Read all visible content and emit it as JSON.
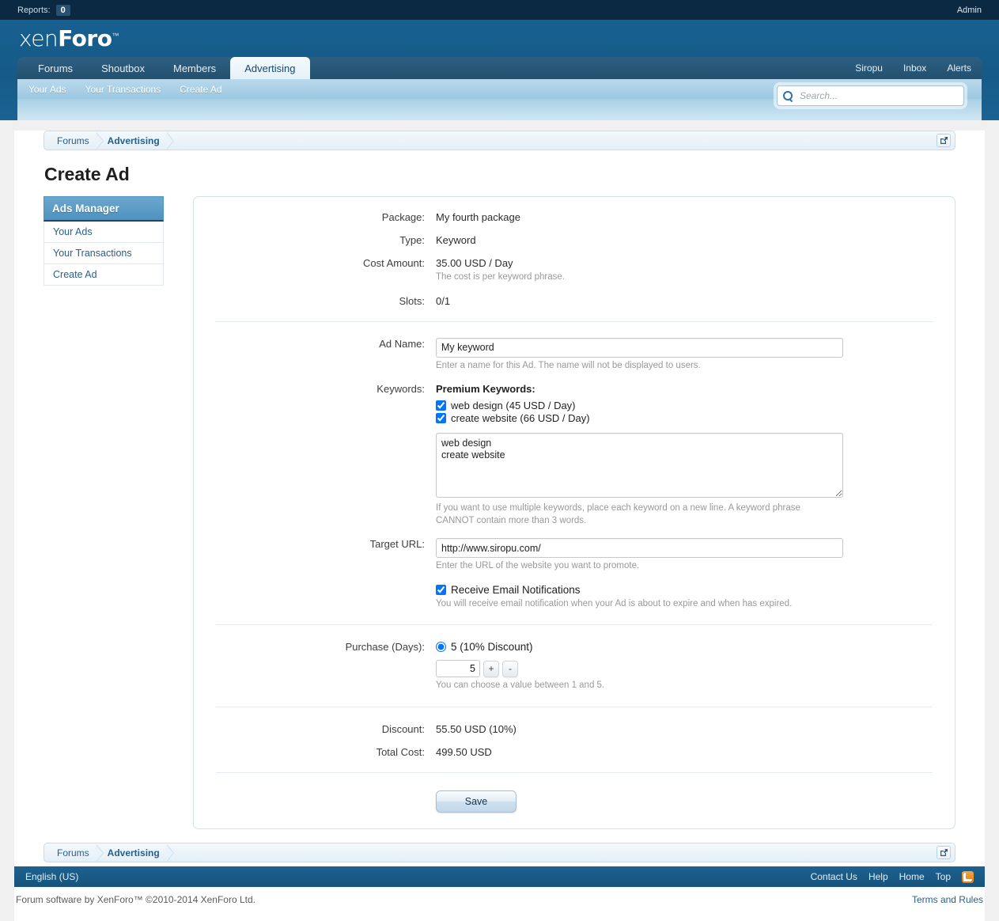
{
  "adminbar": {
    "reports_label": "Reports:",
    "reports_count": "0",
    "admin_link": "Admin"
  },
  "header": {
    "logo_first": "xen",
    "logo_second": "Foro",
    "logo_tm": "™",
    "nav_tabs": [
      {
        "label": "Forums",
        "selected": false
      },
      {
        "label": "Shoutbox",
        "selected": false
      },
      {
        "label": "Members",
        "selected": false
      },
      {
        "label": "Advertising",
        "selected": true
      }
    ],
    "nav_right": [
      {
        "label": "Siropu"
      },
      {
        "label": "Inbox"
      },
      {
        "label": "Alerts"
      }
    ],
    "subnav": [
      {
        "label": "Your Ads"
      },
      {
        "label": "Your Transactions"
      },
      {
        "label": "Create Ad"
      }
    ]
  },
  "search": {
    "placeholder": "Search...",
    "value": "",
    "icon": "search-icon"
  },
  "breadcrumb": {
    "items": [
      {
        "label": "Forums",
        "bold": false
      },
      {
        "label": "Advertising",
        "bold": true
      }
    ],
    "jump_icon": "external-link-icon"
  },
  "page_title": "Create Ad",
  "sidebar": {
    "heading": "Ads Manager",
    "items": [
      {
        "label": "Your Ads"
      },
      {
        "label": "Your Transactions"
      },
      {
        "label": "Create Ad"
      }
    ]
  },
  "form": {
    "package": {
      "label": "Package:",
      "value": "My fourth package"
    },
    "type": {
      "label": "Type:",
      "value": "Keyword"
    },
    "cost_amount": {
      "label": "Cost Amount:",
      "value": "35.00 USD / Day",
      "hint": "The cost is per keyword phrase."
    },
    "slots": {
      "label": "Slots:",
      "value": "0/1"
    },
    "ad_name": {
      "label": "Ad Name:",
      "value": "My keyword",
      "placeholder": "",
      "hint": "Enter a name for this Ad. The name will not be displayed to users."
    },
    "keywords": {
      "label": "Keywords:",
      "premium_title": "Premium Keywords:",
      "premium_items": [
        {
          "label": "web design (45 USD / Day)",
          "checked": true
        },
        {
          "label": "create website (66 USD / Day)",
          "checked": true
        }
      ],
      "textarea_value": "web design\ncreate website",
      "hint": "If you want to use multiple keywords, place each keyword on a new line. A keyword phrase CANNOT contain more than 3 words."
    },
    "target_url": {
      "label": "Target URL:",
      "value": "http://www.siropu.com/",
      "hint": "Enter the URL of the website you want to promote."
    },
    "email_notifications": {
      "label": "Receive Email Notifications",
      "checked": true,
      "hint": "You will receive email notification when your Ad is about to expire and when has expired."
    },
    "purchase": {
      "label": "Purchase (Days):",
      "option_label": "5 (10% Discount)",
      "option_checked": true,
      "stepper_value": "5",
      "plus_label": "+",
      "minus_label": "-",
      "hint": "You can choose a value between 1 and 5."
    },
    "discount": {
      "label": "Discount:",
      "value": "55.50 USD (10%)"
    },
    "total_cost": {
      "label": "Total Cost:",
      "value": "499.50 USD"
    },
    "save_label": "Save"
  },
  "footer": {
    "language": "English (US)",
    "links": [
      {
        "label": "Contact Us"
      },
      {
        "label": "Help"
      },
      {
        "label": "Home"
      },
      {
        "label": "Top"
      }
    ],
    "rss_icon": "rss-icon",
    "copyright": "Forum software by XenForo™ ©2010-2014 XenForo Ltd.",
    "terms": "Terms and Rules"
  },
  "colors": {
    "header_blue": "#17486d",
    "accent_blue": "#2b5f87",
    "sidebar_head": "#4e92bf",
    "green": "#3f8a3f",
    "rss_orange": "#e07c18"
  }
}
